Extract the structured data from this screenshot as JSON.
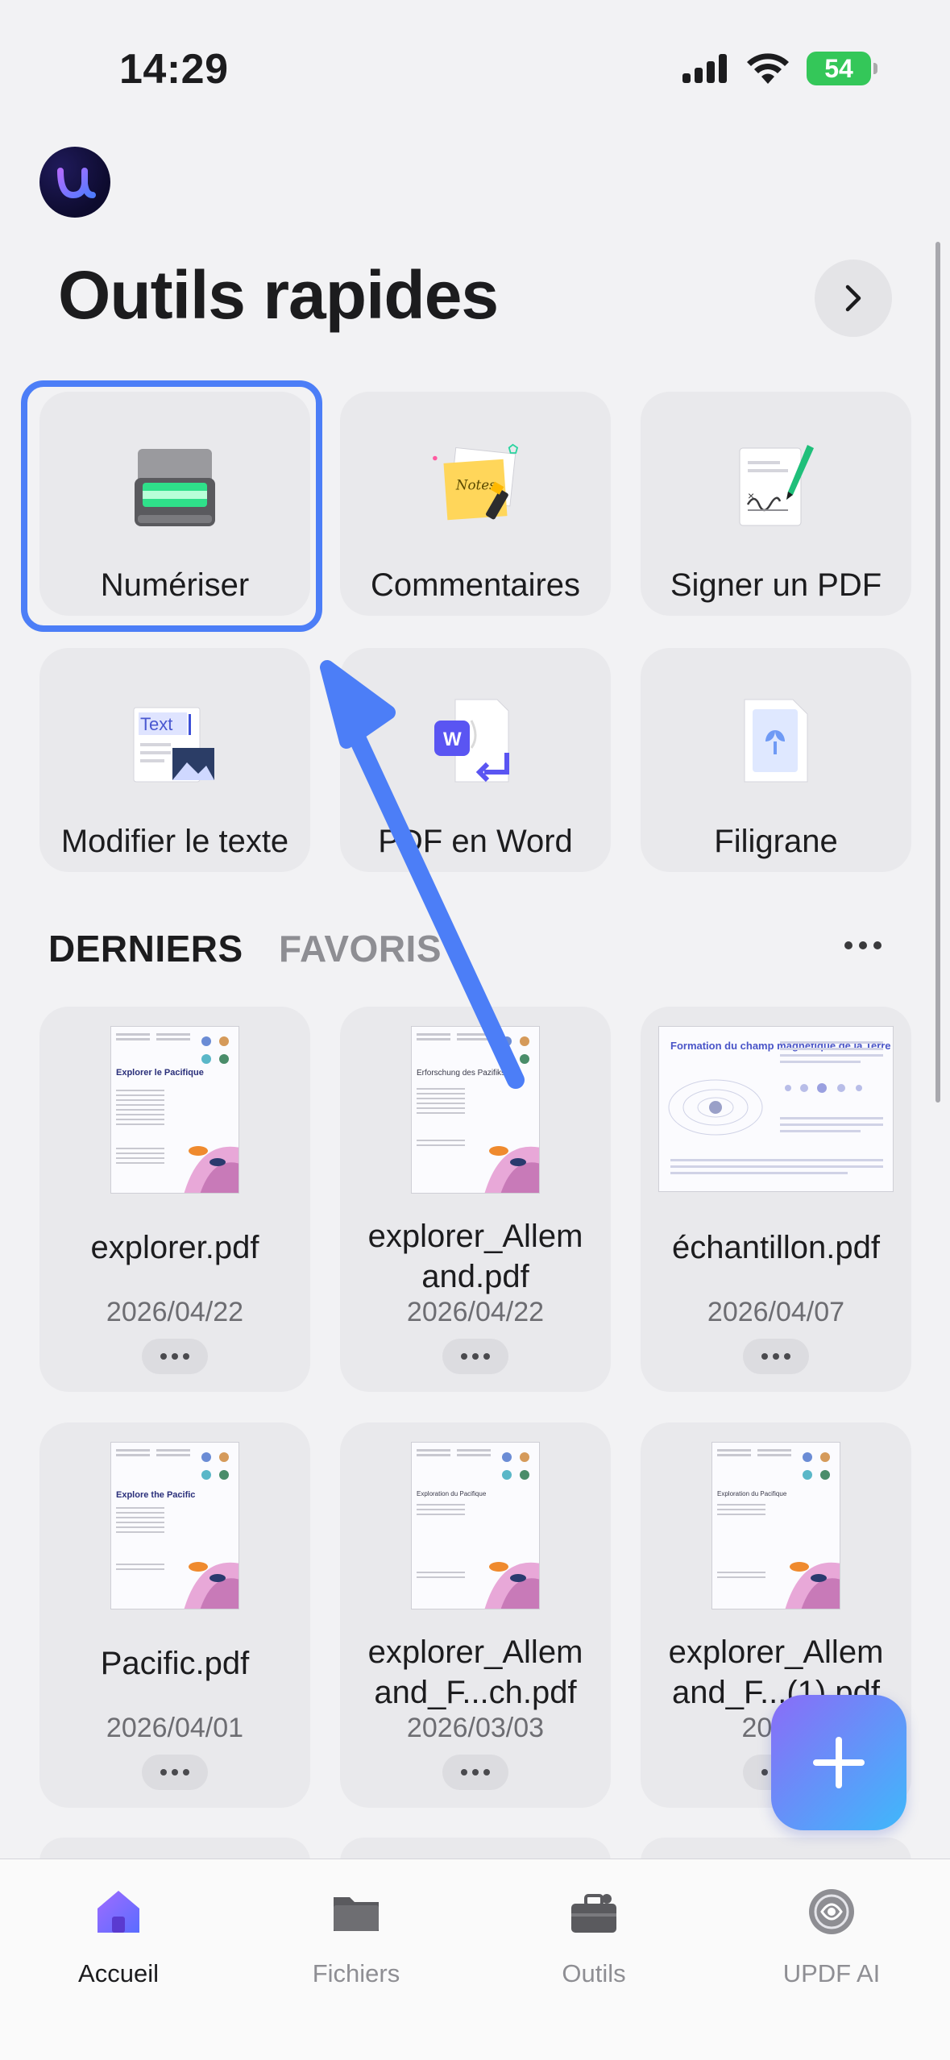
{
  "status_bar": {
    "time": "14:29",
    "battery": "54"
  },
  "header": {
    "title": "Outils rapides"
  },
  "quick_tools": [
    {
      "label": "Numériser",
      "icon": "scanner-icon"
    },
    {
      "label": "Commentaires",
      "icon": "notes-icon"
    },
    {
      "label": "Signer un PDF",
      "icon": "signature-pen-icon"
    },
    {
      "label": "Modifier le texte",
      "icon": "edit-text-icon"
    },
    {
      "label": "PDF en Word",
      "icon": "pdf-to-word-icon"
    },
    {
      "label": "Filigrane",
      "icon": "watermark-icon"
    }
  ],
  "tabs": {
    "recent": "DERNIERS",
    "favorites": "FAVORIS"
  },
  "files": [
    {
      "name": "explorer.pdf",
      "date": "2026/04/22",
      "thumb_title": "Explorer le Pacifique"
    },
    {
      "name": "explorer_Allemand.pdf",
      "name_line1": "explorer_Allem",
      "name_line2": "and.pdf",
      "date": "2026/04/22",
      "thumb_title": "Erforschung des Pazifiks"
    },
    {
      "name": "échantillon.pdf",
      "date": "2026/04/07",
      "thumb_title": "Formation du champ magnétique de la Terre"
    },
    {
      "name": "Pacific.pdf",
      "date": "2026/04/01",
      "thumb_title": "Explore the Pacific"
    },
    {
      "name": "explorer_Allemand_F...ch.pdf",
      "name_line1": "explorer_Allem",
      "name_line2": "and_F...ch.pdf",
      "date": "2026/03/03",
      "thumb_title": "Exploration du Pacifique"
    },
    {
      "name": "explorer_Allemand_F...(1).pdf",
      "name_line1": "explorer_Allem",
      "name_line2": "and_F...(1).pdf",
      "date": "2026/",
      "thumb_title": "Exploration du Pacifique"
    }
  ],
  "tabbar": [
    {
      "label": "Accueil",
      "icon": "home-icon",
      "active": true
    },
    {
      "label": "Fichiers",
      "icon": "folder-icon",
      "active": false
    },
    {
      "label": "Outils",
      "icon": "toolbox-icon",
      "active": false
    },
    {
      "label": "UPDF AI",
      "icon": "ai-icon",
      "active": false
    }
  ],
  "colors": {
    "accent": "#4c7ef7",
    "fab_start": "#8a6cf7",
    "fab_end": "#3fb8fb",
    "battery": "#34c759"
  }
}
